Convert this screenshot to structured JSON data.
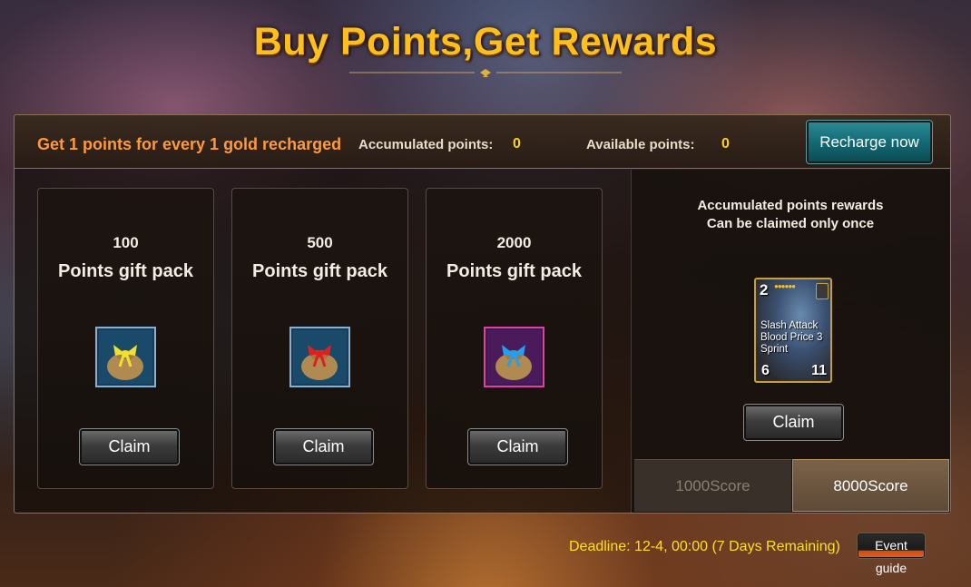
{
  "title": "Buy Points,Get Rewards",
  "header": {
    "promo": "Get 1 points for every 1 gold recharged",
    "accumulated_label": "Accumulated points:",
    "accumulated_value": "0",
    "available_label": "Available points:",
    "available_value": "0",
    "recharge_label": "Recharge now"
  },
  "packs": [
    {
      "points": "100",
      "title": "Points gift pack",
      "claim_label": "Claim",
      "bag_color": "#f0e030",
      "frame_color": "#6ab0e0"
    },
    {
      "points": "500",
      "title": "Points gift pack",
      "claim_label": "Claim",
      "bag_color": "#e02020",
      "frame_color": "#6ab0e0"
    },
    {
      "points": "2000",
      "title": "Points gift pack",
      "claim_label": "Claim",
      "bag_color": "#20a0f0",
      "frame_color": "#e040a0"
    }
  ],
  "rewards": {
    "heading_line1": "Accumulated points rewards",
    "heading_line2": "Can be claimed only once",
    "hero": {
      "level": "2",
      "skill1": "Slash Attack",
      "skill2": "Blood Price 3",
      "skill3": "Sprint",
      "attack": "6",
      "health": "11"
    },
    "claim_label": "Claim",
    "tabs": [
      {
        "label": "1000Score",
        "active": false
      },
      {
        "label": "8000Score",
        "active": true
      }
    ]
  },
  "footer": {
    "deadline": "Deadline: 12-4, 00:00 (7 Days Remaining)",
    "guide_label": "Event guide"
  }
}
